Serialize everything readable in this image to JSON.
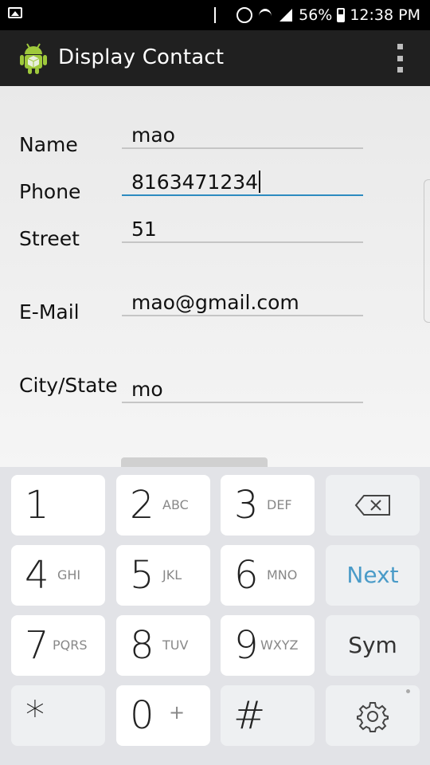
{
  "status_bar": {
    "battery": "56%",
    "time": "12:38 PM",
    "battery_level": 0.56
  },
  "app_bar": {
    "title": "Display Contact"
  },
  "form": {
    "fields": [
      {
        "label": "Name",
        "value": "mao"
      },
      {
        "label": "Phone",
        "value": "8163471234"
      },
      {
        "label": "Street",
        "value": "51"
      },
      {
        "label": "E-Mail",
        "value": "mao@gmail.com"
      },
      {
        "label": "City/State",
        "value": "mo"
      }
    ]
  },
  "keyboard": {
    "keys": [
      {
        "main": "1",
        "sub": ""
      },
      {
        "main": "2",
        "sub": "ABC"
      },
      {
        "main": "3",
        "sub": "DEF"
      },
      {
        "icon": "backspace-icon"
      },
      {
        "main": "4",
        "sub": "GHI"
      },
      {
        "main": "5",
        "sub": "JKL"
      },
      {
        "main": "6",
        "sub": "MNO"
      },
      {
        "label": "Next"
      },
      {
        "main": "7",
        "sub": "PQRS"
      },
      {
        "main": "8",
        "sub": "TUV"
      },
      {
        "main": "9",
        "sub": "WXYZ"
      },
      {
        "label": "Sym"
      },
      {
        "main": "*",
        "sub": ""
      },
      {
        "main": "0",
        "sub": "+"
      },
      {
        "main": "#",
        "sub": ""
      },
      {
        "icon": "settings-gear-icon"
      }
    ]
  },
  "colors": {
    "accent": "#2d8bc0",
    "next_key": "#4a9bc8",
    "action_bar": "#202020"
  }
}
